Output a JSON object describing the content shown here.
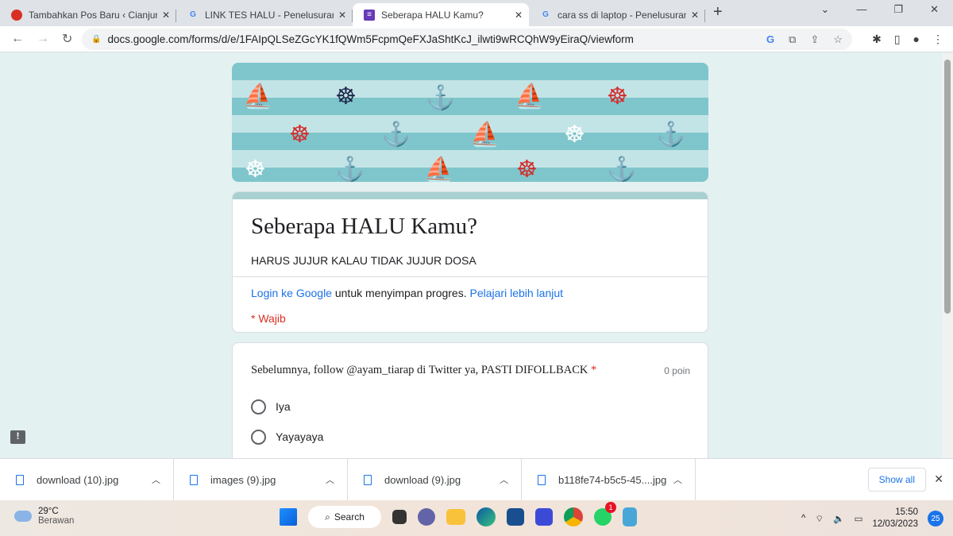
{
  "tabs": [
    {
      "title": "Tambahkan Pos Baru ‹ Cianjur Ek",
      "icon": "site-icon",
      "color": "#d93025"
    },
    {
      "title": "LINK TES HALU - Penelusuran Go",
      "icon": "google-icon",
      "color": "#4285f4"
    },
    {
      "title": "Seberapa HALU Kamu?",
      "icon": "google-forms-icon",
      "color": "#673ab7"
    },
    {
      "title": "cara ss di laptop - Penelusuran G",
      "icon": "google-icon",
      "color": "#4285f4"
    }
  ],
  "url": "docs.google.com/forms/d/e/1FAIpQLSeZGcYK1fQWm5FcpmQeFXJaShtKcJ_ilwti9wRCQhW9yEiraQ/viewform",
  "form": {
    "title": "Seberapa HALU Kamu?",
    "description": "HARUS JUJUR KALAU TIDAK JUJUR DOSA",
    "login_link": "Login ke Google",
    "login_text": " untuk menyimpan progres. ",
    "learn_more": "Pelajari lebih lanjut",
    "required": "* Wajib",
    "question": {
      "text": "Sebelumnya, follow @ayam_tiarap di Twitter ya, PASTI DIFOLLBACK",
      "star": " *",
      "points": "0 poin",
      "options": [
        "Iya",
        "Yayayaya"
      ]
    }
  },
  "downloads": [
    "download (10).jpg",
    "images (9).jpg",
    "download (9).jpg",
    "b118fe74-b5c5-45....jpg"
  ],
  "show_all": "Show all",
  "taskbar": {
    "temp": "29°C",
    "weather": "Berawan",
    "search": "Search",
    "time": "15:50",
    "date": "12/03/2023",
    "notif": "25",
    "whatsapp_badge": "1"
  },
  "colors": {
    "accent": "#a8d0d0",
    "link": "#1a73e8",
    "required": "#d93025"
  }
}
